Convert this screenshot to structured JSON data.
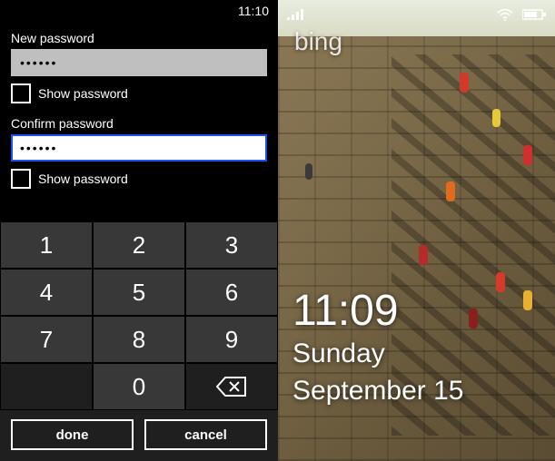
{
  "left": {
    "status_time": "11:10",
    "new_password_label": "New password",
    "new_password_value": "••••••",
    "confirm_password_label": "Confirm password",
    "confirm_password_value": "••••••",
    "show_password_label": "Show password",
    "keypad": {
      "k1": "1",
      "k2": "2",
      "k3": "3",
      "k4": "4",
      "k5": "5",
      "k6": "6",
      "k7": "7",
      "k8": "8",
      "k9": "9",
      "k0": "0"
    },
    "done_label": "done",
    "cancel_label": "cancel"
  },
  "right": {
    "brand": "bing",
    "time": "11:09",
    "day": "Sunday",
    "date": "September 15"
  }
}
